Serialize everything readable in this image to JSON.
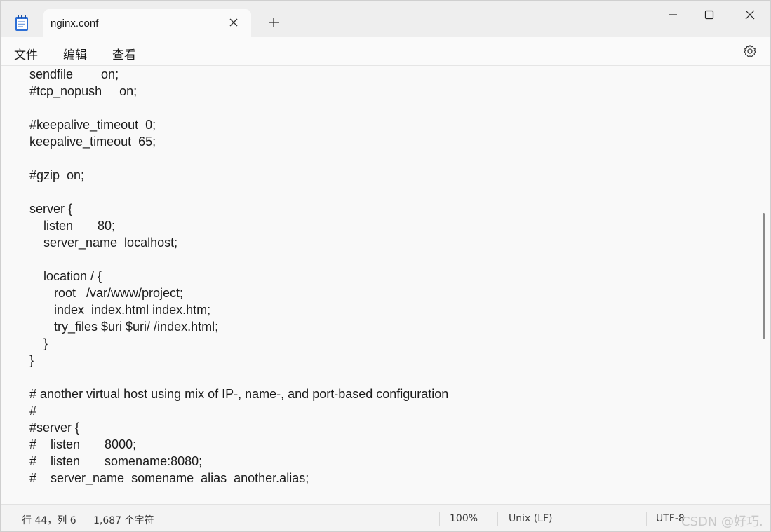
{
  "tab": {
    "title": "nginx.conf"
  },
  "menu": [
    "文件",
    "编辑",
    "查看"
  ],
  "editor": {
    "lines": [
      "sendfile        on;",
      "#tcp_nopush     on;",
      "",
      "#keepalive_timeout  0;",
      "keepalive_timeout  65;",
      "",
      "#gzip  on;",
      "",
      "server {",
      "    listen       80;",
      "    server_name  localhost;",
      "",
      "    location / {",
      "       root   /var/www/project;",
      "       index  index.html index.htm;",
      "       try_files $uri $uri/ /index.html;",
      "    }",
      "}",
      "",
      "# another virtual host using mix of IP-, name-, and port-based configuration",
      "#",
      "#server {",
      "#    listen       8000;",
      "#    listen       somename:8080;",
      "#    server_name  somename  alias  another.alias;"
    ]
  },
  "status": {
    "position": "行 44，列 6",
    "char_count": "1,687 个字符",
    "zoom": "100%",
    "line_ending": "Unix (LF)",
    "encoding": "UTF-8",
    "watermark": "CSDN @好巧."
  },
  "icons": {
    "app": "notepad-icon",
    "tab_close": "close-icon",
    "new_tab": "plus-icon",
    "minimize": "minimize-icon",
    "maximize": "maximize-icon",
    "close": "close-icon",
    "settings": "gear-icon"
  }
}
